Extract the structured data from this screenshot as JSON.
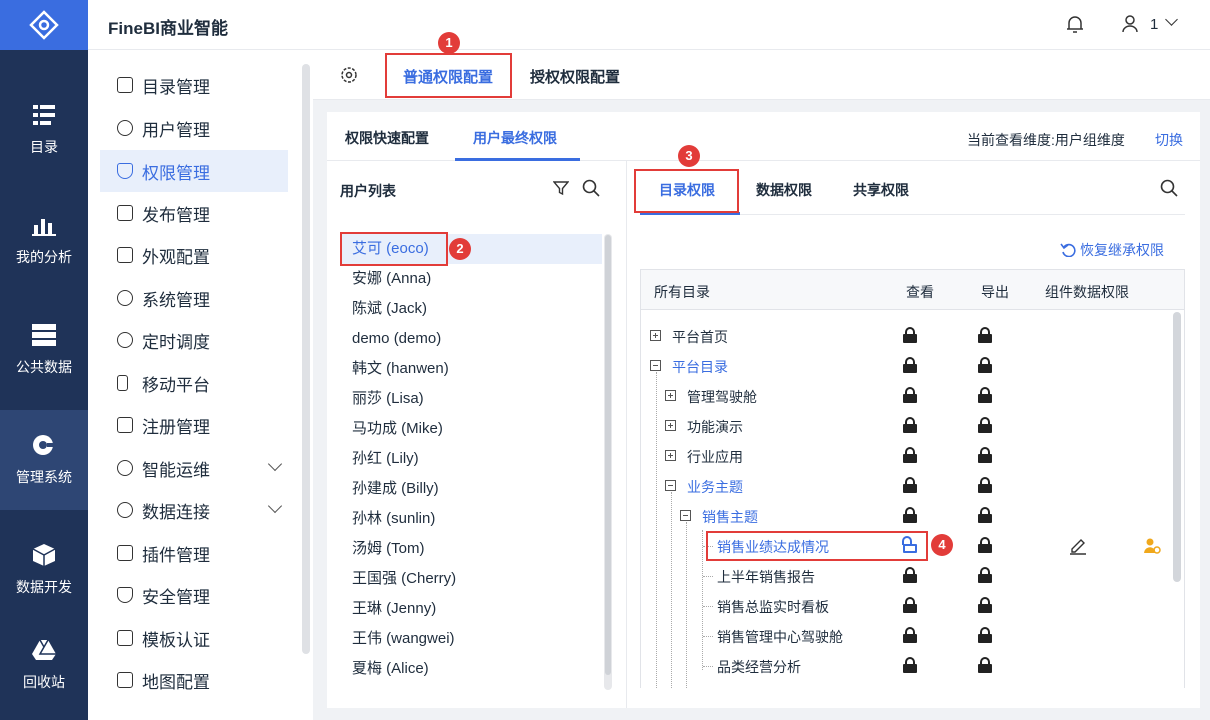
{
  "app": {
    "title": "FineBI商业智能",
    "user": "1"
  },
  "rail": [
    {
      "label": "目录",
      "icon": "catalog-icon"
    },
    {
      "label": "我的分析",
      "icon": "analysis-icon"
    },
    {
      "label": "公共数据",
      "icon": "database-icon"
    },
    {
      "label": "管理系统",
      "icon": "gear-icon",
      "active": true
    },
    {
      "label": "数据开发",
      "icon": "cube-icon"
    },
    {
      "label": "回收站",
      "icon": "drive-icon"
    }
  ],
  "menu": [
    {
      "label": "目录管理"
    },
    {
      "label": "用户管理"
    },
    {
      "label": "权限管理",
      "active": true
    },
    {
      "label": "发布管理"
    },
    {
      "label": "外观配置"
    },
    {
      "label": "系统管理"
    },
    {
      "label": "定时调度"
    },
    {
      "label": "移动平台"
    },
    {
      "label": "注册管理"
    },
    {
      "label": "智能运维",
      "expand": true
    },
    {
      "label": "数据连接",
      "expand": true
    },
    {
      "label": "插件管理"
    },
    {
      "label": "安全管理"
    },
    {
      "label": "模板认证"
    },
    {
      "label": "地图配置"
    }
  ],
  "tabs": {
    "normal": "普通权限配置",
    "grant": "授权权限配置"
  },
  "subtabs": {
    "quick": "权限快速配置",
    "final": "用户最终权限"
  },
  "dimension": {
    "text": "当前查看维度:用户组维度",
    "switch": "切换"
  },
  "userlist": {
    "title": "用户列表",
    "users": [
      "艾可 (eoco)",
      "安娜 (Anna)",
      "陈斌 (Jack)",
      "demo (demo)",
      "韩文 (hanwen)",
      "丽莎 (Lisa)",
      "马功成 (Mike)",
      "孙红 (Lily)",
      "孙建成 (Billy)",
      "孙林 (sunlin)",
      "汤姆 (Tom)",
      "王国强 (Cherry)",
      "王琳 (Jenny)",
      "王伟 (wangwei)",
      "夏梅 (Alice)"
    ]
  },
  "permtabs": {
    "catalog": "目录权限",
    "data": "数据权限",
    "share": "共享权限"
  },
  "restore": "恢复继承权限",
  "grid": {
    "headers": [
      "所有目录",
      "查看",
      "导出",
      "组件数据权限"
    ],
    "rows": [
      {
        "label": "平台首页"
      },
      {
        "label": "平台目录"
      },
      {
        "label": "管理驾驶舱"
      },
      {
        "label": "功能演示"
      },
      {
        "label": "行业应用"
      },
      {
        "label": "业务主题"
      },
      {
        "label": "销售主题"
      },
      {
        "label": "销售业绩达成情况"
      },
      {
        "label": "上半年销售报告"
      },
      {
        "label": "销售总监实时看板"
      },
      {
        "label": "销售管理中心驾驶舱"
      },
      {
        "label": "品类经营分析"
      }
    ]
  },
  "badges": [
    "1",
    "2",
    "3",
    "4"
  ]
}
